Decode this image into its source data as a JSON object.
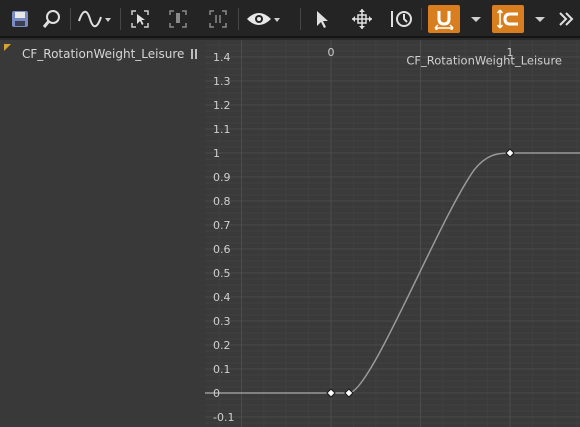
{
  "toolbar": {
    "buttons": [
      {
        "name": "save-icon"
      },
      {
        "name": "find-icon"
      },
      {
        "name": "curve-interp-dropdown-icon"
      },
      {
        "name": "frame-selection-icon"
      },
      {
        "name": "frame-horizontal-icon"
      },
      {
        "name": "frame-vertical-icon"
      },
      {
        "name": "visibility-dropdown-icon"
      },
      {
        "name": "select-tool-icon"
      },
      {
        "name": "transform-tool-icon"
      },
      {
        "name": "retime-tool-icon"
      },
      {
        "name": "snap-time-icon"
      },
      {
        "name": "snap-time-dropdown-icon"
      },
      {
        "name": "snap-value-icon"
      },
      {
        "name": "snap-value-dropdown-icon"
      },
      {
        "name": "overflow-icon"
      }
    ],
    "accent_color": "#d97e1e"
  },
  "left_panel": {
    "curve_name": "CF_RotationWeight_Leisure"
  },
  "graph": {
    "curve_label": "CF_RotationWeight_Leisure",
    "background": "#3a3a3a",
    "curve_color": "#9a9a9a"
  },
  "chart_data": {
    "type": "line",
    "x_ticks": [
      "0",
      "1"
    ],
    "y_ticks": [
      "1.4",
      "1.3",
      "1.2",
      "1.1",
      "1",
      "0.9",
      "0.8",
      "0.7",
      "0.6",
      "0.5",
      "0.4",
      "0.3",
      "0.2",
      "0.1",
      "0",
      "-0.1"
    ],
    "xlim": [
      -0.65,
      1.4
    ],
    "ylim": [
      -0.12,
      1.44
    ],
    "keys": [
      {
        "x": 0,
        "y": 0
      },
      {
        "x": 0.1,
        "y": 0
      },
      {
        "x": 1,
        "y": 1
      }
    ],
    "curve_points": [
      {
        "x": -0.65,
        "y": 0
      },
      {
        "x": 0,
        "y": 0
      },
      {
        "x": 0.1,
        "y": 0
      },
      {
        "x": 1,
        "y": 1
      },
      {
        "x": 1.4,
        "y": 1
      }
    ],
    "series": [
      {
        "name": "CF_RotationWeight_Leisure"
      }
    ]
  }
}
